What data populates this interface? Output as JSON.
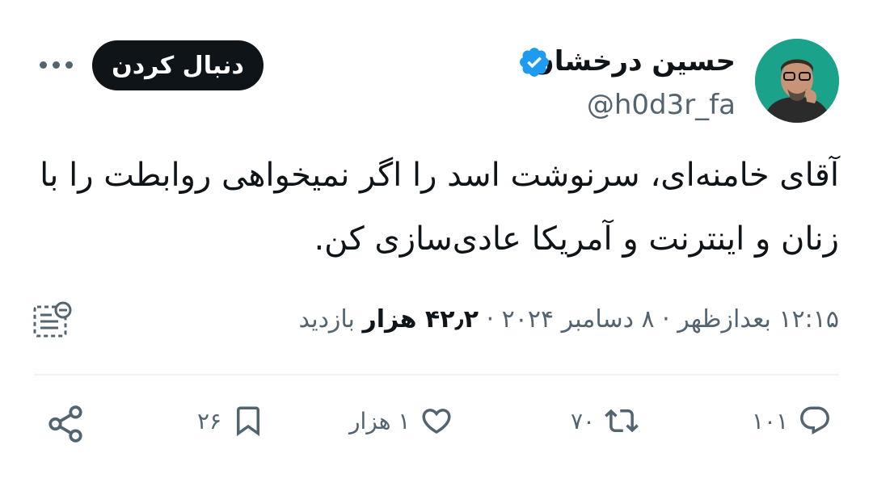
{
  "user": {
    "display_name": "حسین درخشان",
    "handle": "@h0d3r_fa",
    "verified_icon": "verified-badge-icon",
    "avatar_bg": "#1aa38a"
  },
  "follow_button": {
    "label": "دنبال کردن"
  },
  "more_icon": "more-horizontal-icon",
  "tweet": {
    "lines": [
      "آقای خامنه‌ای، سرنوشت اسد را اگر نمیخواهی روابطت را با",
      "زنان و اینترنت و آمریکا عادی‌سازی کن."
    ]
  },
  "meta": {
    "time": "۱۲:۱۵ بعدازظهر",
    "sep1": " · ",
    "date": "۸ دسامبر ۲۰۲۴",
    "sep2": " · ",
    "views_count": "۴۲٫۲ هزار",
    "views_label": " بازدید"
  },
  "actions": {
    "reply_count": "۱۰۱",
    "retweet_count": "۷۰",
    "like_count": "۱ هزار",
    "bookmark_count": "۲۶"
  },
  "colors": {
    "text": "#0f1419",
    "secondary": "#536471",
    "verified": "#1d9bf0",
    "divider": "#eff3f4"
  }
}
